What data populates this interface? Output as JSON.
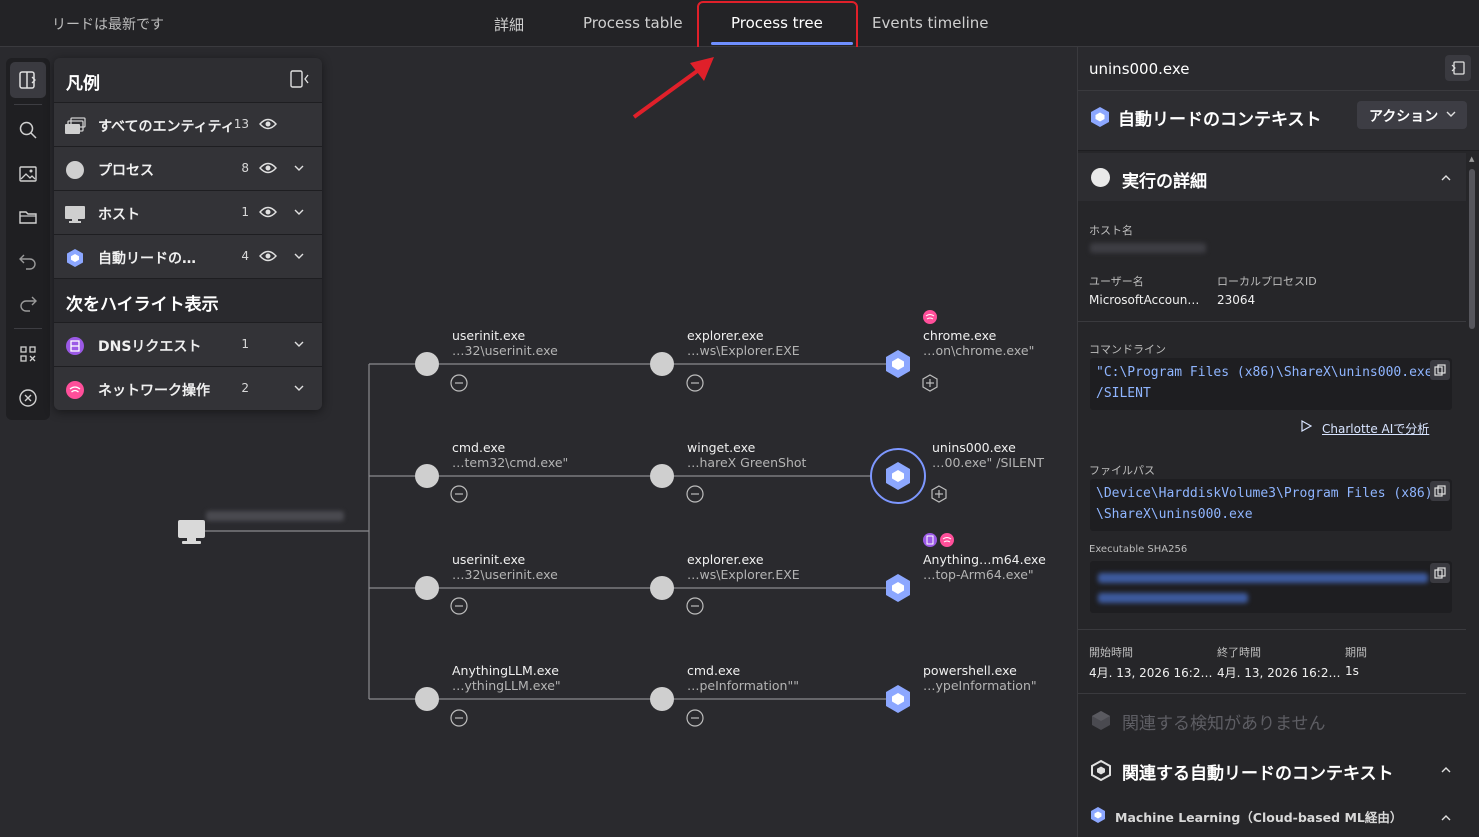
{
  "topbar": {
    "status": "リードは最新です",
    "tabs": [
      {
        "label": "詳細"
      },
      {
        "label": "Process table"
      },
      {
        "label": "Process tree"
      },
      {
        "label": "Events timeline"
      }
    ],
    "active_tab": "Process tree"
  },
  "legend": {
    "title": "凡例",
    "rows": [
      {
        "label": "すべてのエンティティ",
        "count": "13"
      },
      {
        "label": "プロセス",
        "count": "8"
      },
      {
        "label": "ホスト",
        "count": "1"
      },
      {
        "label": "自動リードの…",
        "count": "4"
      }
    ],
    "highlight_title": "次をハイライト表示",
    "highlight_rows": [
      {
        "label": "DNSリクエスト",
        "count": "1"
      },
      {
        "label": "ネットワーク操作",
        "count": "2"
      }
    ]
  },
  "tree": {
    "rows": [
      {
        "n1": {
          "name": "userinit.exe",
          "sub": "…32\\userinit.exe"
        },
        "n2": {
          "name": "explorer.exe",
          "sub": "…ws\\Explorer.EXE"
        },
        "n3": {
          "name": "chrome.exe",
          "sub": "…on\\chrome.exe\""
        }
      },
      {
        "n1": {
          "name": "cmd.exe",
          "sub": "…tem32\\cmd.exe\""
        },
        "n2": {
          "name": "winget.exe",
          "sub": "…hareX GreenShot"
        },
        "n3": {
          "name": "unins000.exe",
          "sub": "…00.exe\" /SILENT"
        }
      },
      {
        "n1": {
          "name": "userinit.exe",
          "sub": "…32\\userinit.exe"
        },
        "n2": {
          "name": "explorer.exe",
          "sub": "…ws\\Explorer.EXE"
        },
        "n3": {
          "name": "Anything…m64.exe",
          "sub": "…top-Arm64.exe\""
        }
      },
      {
        "n1": {
          "name": "AnythingLLM.exe",
          "sub": "…ythingLLM.exe\""
        },
        "n2": {
          "name": "cmd.exe",
          "sub": "…peInformation\"\""
        },
        "n3": {
          "name": "powershell.exe",
          "sub": "…ypeInformation\""
        }
      }
    ]
  },
  "panel": {
    "title": "unins000.exe",
    "context_title": "自動リードのコンテキスト",
    "action_label": "アクション",
    "exec_title": "実行の詳細",
    "host_label": "ホスト名",
    "user_label": "ユーザー名",
    "user_value": "MicrosoftAccoun…",
    "pid_label": "ローカルプロセスID",
    "pid_value": "23064",
    "cmd_label": "コマンドライン",
    "cmd_line1": "\"C:\\Program Files (x86)\\ShareX\\unins000.exe\"",
    "cmd_line2": "/SILENT",
    "ai_link": "Charlotte AIで分析",
    "path_label": "ファイルパス",
    "path_line1": "\\Device\\HarddiskVolume3\\Program Files (x86)",
    "path_line2": "\\ShareX\\unins000.exe",
    "sha_label": "Executable SHA256",
    "start_label": "開始時間",
    "start_value": "4月. 13, 2026 16:2…",
    "end_label": "終了時間",
    "end_value": "4月. 13, 2026 16:2…",
    "duration_label": "期間",
    "duration_value": "1s",
    "no_detections": "関連する検知がありません",
    "related_title": "関連する自動リードのコンテキスト",
    "ml_label": "Machine Learning（Cloud-based ML経由）"
  },
  "colors": {
    "accent": "#6f8fff",
    "hex_node": "#8ca7ff",
    "dns": "#9b59e6",
    "network": "#ff4f9a",
    "highlight": "#e0202a"
  }
}
